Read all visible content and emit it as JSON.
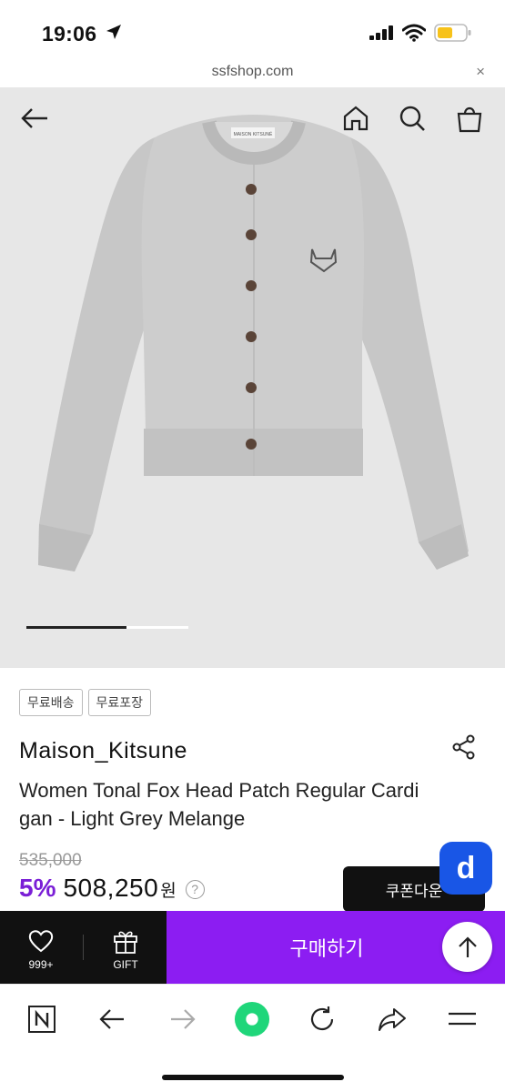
{
  "status": {
    "time": "19:06"
  },
  "urlbar": {
    "url": "ssfshop.com",
    "close": "×"
  },
  "gallery": {
    "progress": 0.62,
    "patch_text": "MAISON KITSUNÉ"
  },
  "tags": [
    "무료배송",
    "무료포장"
  ],
  "product": {
    "brand": "Maison_Kitsune",
    "name": "Women Tonal Fox Head Patch Regular Cardigan - Light Grey Melange",
    "original_price": "535,000",
    "discount": "5%",
    "price": "508,250",
    "currency": "원",
    "help": "?"
  },
  "coupon": {
    "label": "쿠폰다운"
  },
  "badge": {
    "letter": "d"
  },
  "buybar": {
    "wish_count": "999+",
    "gift_label": "GIFT",
    "buy_label": "구매하기"
  },
  "colors": {
    "purple": "#8c1df2",
    "discount": "#7a1fd6",
    "badge_blue": "#1956e6"
  },
  "toolbar": {
    "icons": [
      "naver-icon",
      "back-icon",
      "forward-icon",
      "green-dot-icon",
      "reload-icon",
      "share-icon",
      "menu-icon"
    ]
  }
}
